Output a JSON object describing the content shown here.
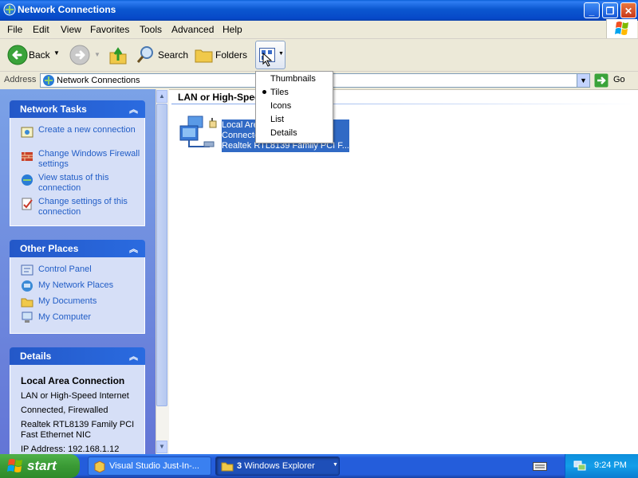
{
  "window": {
    "title": "Network Connections"
  },
  "menu": [
    "File",
    "Edit",
    "View",
    "Favorites",
    "Tools",
    "Advanced",
    "Help"
  ],
  "toolbar": {
    "back": "Back",
    "search": "Search",
    "folders": "Folders"
  },
  "address": {
    "label": "Address",
    "value": "Network Connections",
    "go": "Go"
  },
  "network_tasks": {
    "title": "Network Tasks",
    "items": [
      "Create a new connection",
      "Change Windows Firewall settings",
      "View status of this connection",
      "Change settings of this connection"
    ]
  },
  "other_places": {
    "title": "Other Places",
    "items": [
      "Control Panel",
      "My Network Places",
      "My Documents",
      "My Computer"
    ]
  },
  "details": {
    "title": "Details",
    "name": "Local Area Connection",
    "lines": [
      "LAN or High-Speed Internet",
      "Connected, Firewalled",
      "Realtek RTL8139 Family PCI Fast Ethernet NIC",
      "IP Address: 192.168.1.12"
    ]
  },
  "content": {
    "group_header": "LAN or High-Spee",
    "item": {
      "line1": "Local Area",
      "line2": "Connecte",
      "line3": "Realtek RTL8139 Family PCI F..."
    }
  },
  "views_menu": {
    "items": [
      "Thumbnails",
      "Tiles",
      "Icons",
      "List",
      "Details"
    ],
    "selected": "Tiles"
  },
  "taskbar": {
    "start": "start",
    "tasks": [
      "Visual Studio Just-In-...",
      "3",
      "Windows Explorer"
    ],
    "clock": "9:24 PM"
  },
  "colors": {
    "title_blue": "#0b57d0",
    "link_blue": "#215dc6",
    "selection": "#316ac5",
    "start_green": "#3a9a35"
  }
}
